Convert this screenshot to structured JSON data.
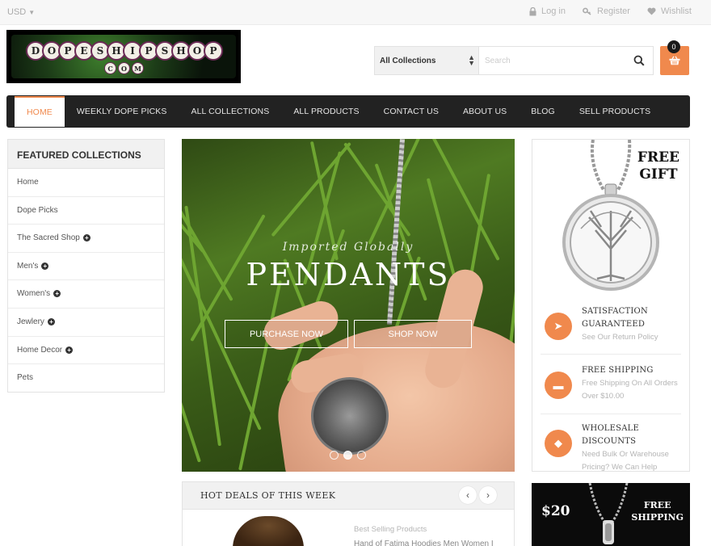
{
  "topbar": {
    "currency": "USD",
    "login": "Log in",
    "register": "Register",
    "wishlist": "Wishlist"
  },
  "logo": {
    "row1": [
      "D",
      "O",
      "P",
      "E",
      "S",
      "H",
      "I",
      "P",
      "S",
      "H",
      "O",
      "P"
    ],
    "row2": [
      "C",
      "O",
      "M"
    ]
  },
  "search": {
    "category": "All Collections",
    "placeholder": "Search"
  },
  "cart": {
    "count": "0"
  },
  "nav": {
    "items": [
      "HOME",
      "WEEKLY DOPE PICKS",
      "ALL COLLECTIONS",
      "ALL PRODUCTS",
      "CONTACT US",
      "ABOUT US",
      "BLOG",
      "SELL PRODUCTS"
    ],
    "active_index": 0
  },
  "sidebar": {
    "title": "FEATURED COLLECTIONS",
    "items": [
      {
        "label": "Home",
        "expandable": false
      },
      {
        "label": "Dope Picks",
        "expandable": false
      },
      {
        "label": "The Sacred Shop",
        "expandable": true
      },
      {
        "label": "Men's",
        "expandable": true
      },
      {
        "label": "Women's",
        "expandable": true
      },
      {
        "label": "Jewlery",
        "expandable": true
      },
      {
        "label": "Home Decor",
        "expandable": true
      },
      {
        "label": "Pets",
        "expandable": false
      }
    ]
  },
  "hero": {
    "subtitle": "Imported Globally",
    "title": "PENDANTS",
    "purchase_label": "PURCHASE NOW",
    "shop_label": "SHOP NOW",
    "slide_count": 3,
    "active_slide": 2
  },
  "gift": {
    "line1": "FREE",
    "line2": "GIFT"
  },
  "features": [
    {
      "icon": "paper-plane-icon",
      "title1": "SATISFACTION",
      "title2": "GUARANTEED",
      "desc1": "See Our Return Policy",
      "desc2": ""
    },
    {
      "icon": "truck-icon",
      "title1": "FREE SHIPPING",
      "title2": "",
      "desc1": "Free Shipping On All Orders",
      "desc2": "Over $10.00"
    },
    {
      "icon": "tag-icon",
      "title1": "WHOLESALE",
      "title2": "DISCOUNTS",
      "desc1": "Need Bulk Or Warehouse",
      "desc2": "Pricing? We Can Help"
    }
  ],
  "deals": {
    "title": "HOT DEALS OF THIS WEEK",
    "category": "Best Selling Products",
    "product_name": "Hand of Fatima Hoodies Men Women I"
  },
  "promo": {
    "price": "$20",
    "line1": "FREE",
    "line2": "SHIPPING"
  },
  "colors": {
    "accent": "#f0894d",
    "nav_bg": "#222222"
  }
}
